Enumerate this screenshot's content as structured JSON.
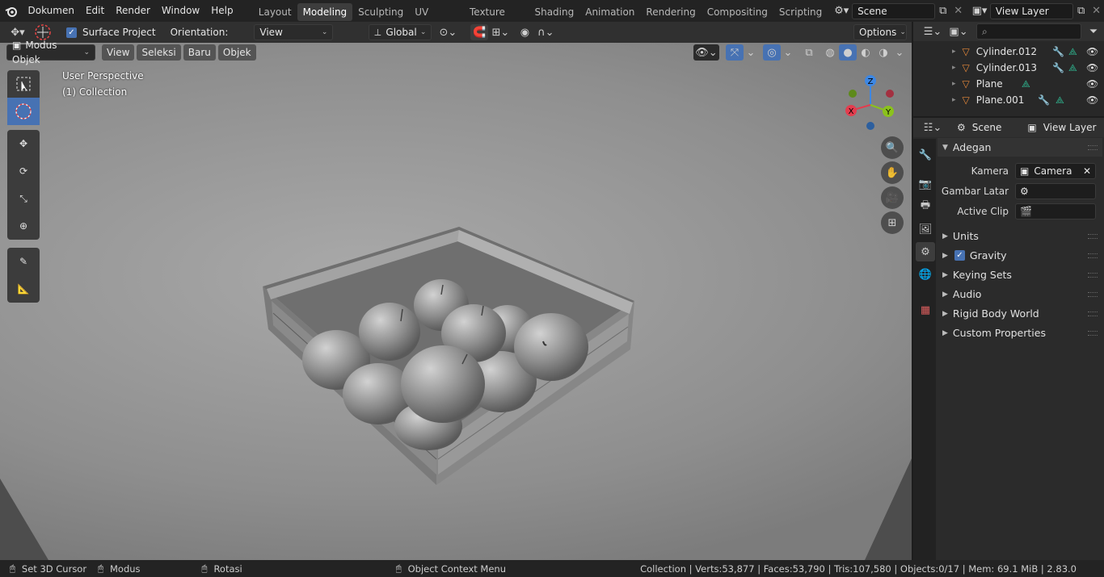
{
  "topbar": {
    "menus": [
      "Dokumen",
      "Edit",
      "Render",
      "Window",
      "Help"
    ],
    "workspaces": [
      "Layout",
      "Modeling",
      "Sculpting",
      "UV Editing",
      "Texture Paint",
      "Shading",
      "Animation",
      "Rendering",
      "Compositing",
      "Scripting"
    ],
    "active_workspace": "Modeling",
    "scene_name": "Scene",
    "view_layer_name": "View Layer"
  },
  "tool_header": {
    "surface_project_label": "Surface Project",
    "surface_project_checked": true,
    "orientation_label": "Orientation:",
    "orientation_value": "View",
    "transform_orientation": "Global",
    "options_label": "Options"
  },
  "viewport_header": {
    "mode": "Modus Objek",
    "menus": [
      "View",
      "Seleksi",
      "Baru",
      "Objek"
    ]
  },
  "viewport": {
    "perspective_label": "User Perspective",
    "collection_label": "(1) Collection",
    "gizmo_axes": {
      "x": "X",
      "y": "Y",
      "z": "Z"
    }
  },
  "outliner": {
    "search_placeholder": "",
    "items": [
      {
        "name": "Cylinder.012",
        "has_modifier": true
      },
      {
        "name": "Cylinder.013",
        "has_modifier": true
      },
      {
        "name": "Plane",
        "has_modifier": false
      },
      {
        "name": "Plane.001",
        "has_modifier": true
      }
    ]
  },
  "properties": {
    "header_scene": "Scene",
    "header_view_layer": "View Layer",
    "panel_title": "Adegan",
    "fields": [
      {
        "label": "Kamera",
        "value": "Camera"
      },
      {
        "label": "Gambar Latar",
        "value": ""
      },
      {
        "label": "Active Clip",
        "value": ""
      }
    ],
    "subpanels": [
      "Units",
      "Gravity",
      "Keying Sets",
      "Audio",
      "Rigid Body World",
      "Custom Properties"
    ],
    "gravity_checked": true
  },
  "statusbar": {
    "set_cursor": "Set 3D Cursor",
    "modus": "Modus",
    "rotasi": "Rotasi",
    "context_menu": "Object Context Menu",
    "stats": "Collection | Verts:53,877 | Faces:53,790 | Tris:107,580 | Objects:0/17 | Mem: 69.1 MiB | 2.83.0"
  },
  "colors": {
    "accent": "#4772b3",
    "axis_x": "#e33d4e",
    "axis_y": "#8bc21c",
    "axis_z": "#3d87e3",
    "object_icon": "#e6883a",
    "mesh_icon": "#2fb58f"
  }
}
